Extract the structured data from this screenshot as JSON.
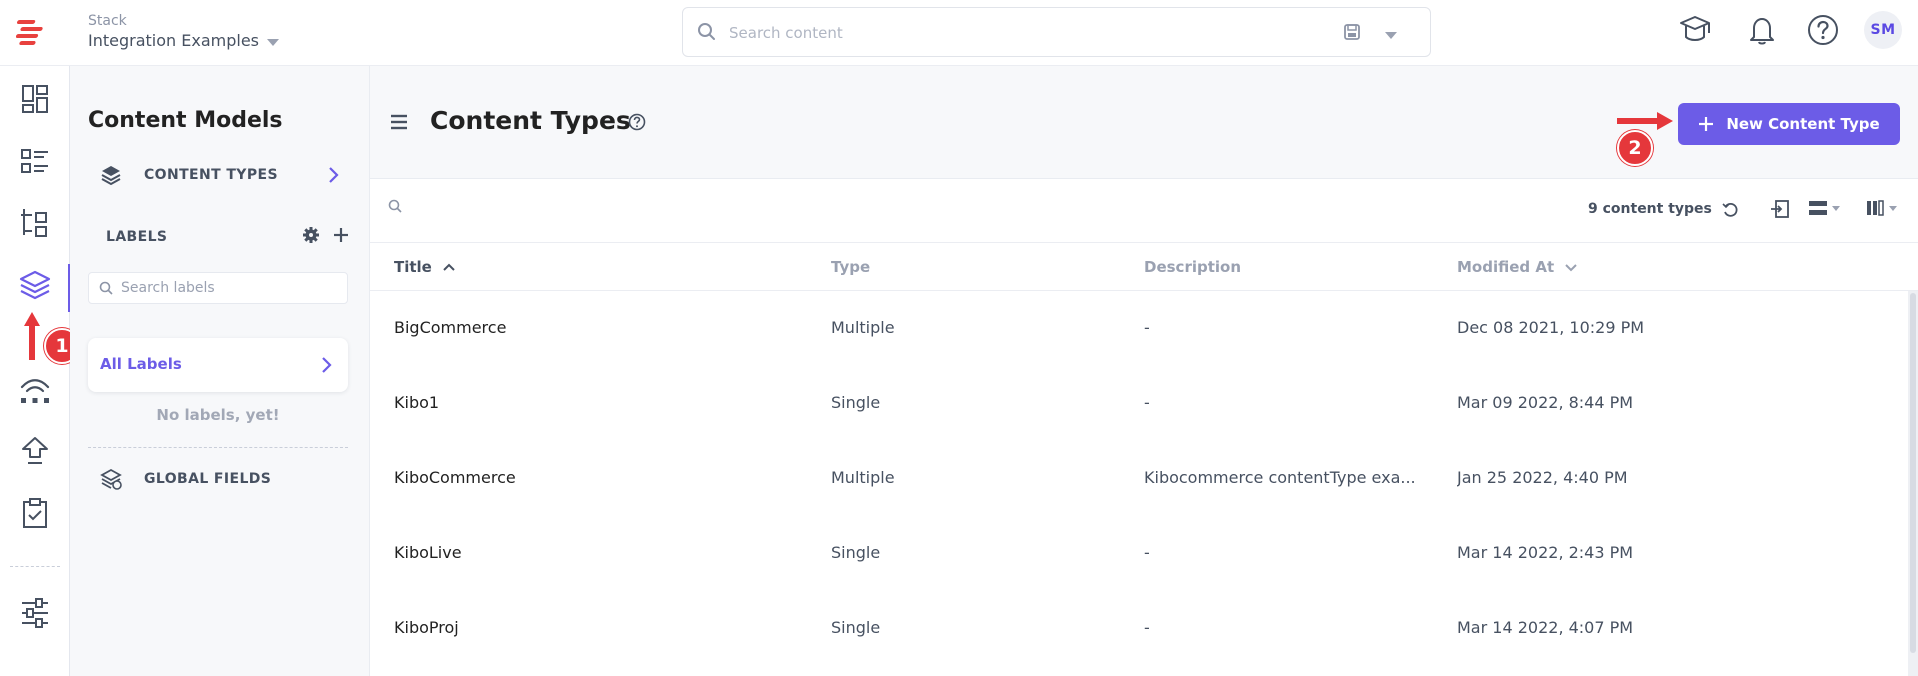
{
  "colors": {
    "accent": "#6c5ce7",
    "annotation": "#e5373b",
    "text_dark": "#222222",
    "text_muted": "#9aa1b1"
  },
  "header": {
    "stack_label": "Stack",
    "stack_name": "Integration Examples",
    "search_placeholder": "Search content",
    "avatar_initials": "SM"
  },
  "rail": {
    "items": [
      "dashboard-icon",
      "entries-icon",
      "assets-icon",
      "content-models-icon",
      "releases-icon",
      "publish-queue-icon",
      "tasks-icon",
      "settings-sliders-icon"
    ],
    "active": "content-models-icon"
  },
  "models_panel": {
    "title": "Content Models",
    "content_types_label": "CONTENT TYPES",
    "labels_heading": "LABELS",
    "label_search_placeholder": "Search labels",
    "all_labels": "All Labels",
    "no_labels": "No labels, yet!",
    "global_fields_label": "GLOBAL FIELDS"
  },
  "main": {
    "title": "Content Types",
    "new_button": "New Content Type",
    "count_text": "9 content types",
    "columns": {
      "title": "Title",
      "type": "Type",
      "description": "Description",
      "modified": "Modified At"
    },
    "rows": [
      {
        "title": "BigCommerce",
        "type": "Multiple",
        "description": "-",
        "modified": "Dec 08 2021, 10:29 PM"
      },
      {
        "title": "Kibo1",
        "type": "Single",
        "description": "-",
        "modified": "Mar 09 2022, 8:44 PM"
      },
      {
        "title": "KiboCommerce",
        "type": "Multiple",
        "description": "Kibocommerce contentType exa...",
        "modified": "Jan 25 2022, 4:40 PM"
      },
      {
        "title": "KiboLive",
        "type": "Single",
        "description": "-",
        "modified": "Mar 14 2022, 2:43 PM"
      },
      {
        "title": "KiboProj",
        "type": "Single",
        "description": "-",
        "modified": "Mar 14 2022, 4:07 PM"
      }
    ]
  },
  "annotations": {
    "step1": "1",
    "step2": "2"
  }
}
